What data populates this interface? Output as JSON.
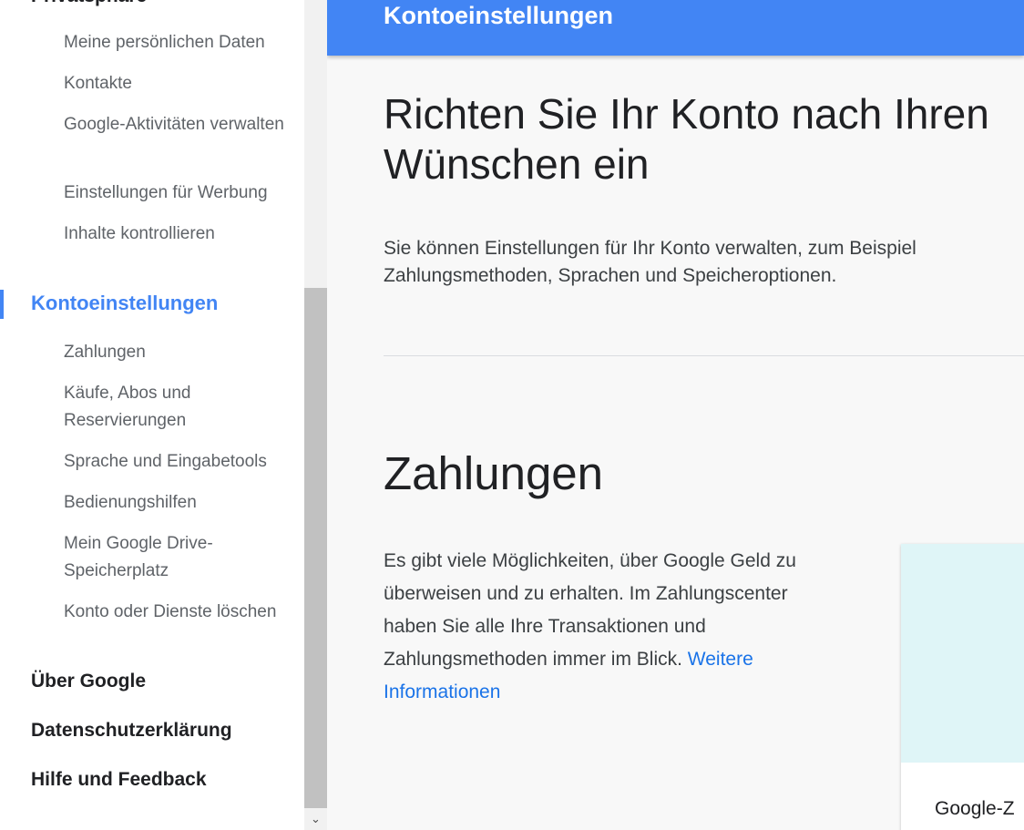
{
  "sidebar": {
    "privacy_heading": "Privatsphäre",
    "privacy_items": [
      {
        "label": "Meine persönlichen Daten"
      },
      {
        "label": "Kontakte"
      },
      {
        "label": "Google-Aktivitäten verwalten"
      },
      {
        "label": "Einstellungen für Werbung"
      },
      {
        "label": "Inhalte kontrollieren"
      }
    ],
    "account_heading": "Kontoeinstellungen",
    "account_items": [
      {
        "label": "Zahlungen"
      },
      {
        "label": "Käufe, Abos und Reservierungen"
      },
      {
        "label": "Sprache und Eingabetools"
      },
      {
        "label": "Bedienungshilfen"
      },
      {
        "label": "Mein Google Drive-Speicherplatz"
      },
      {
        "label": "Konto oder Dienste löschen"
      }
    ],
    "bottom_links": [
      {
        "label": "Über Google"
      },
      {
        "label": "Datenschutzerklärung"
      },
      {
        "label": "Hilfe und Feedback"
      }
    ]
  },
  "scrollbar": {
    "down_arrow": "⌄"
  },
  "header": {
    "title": "Kontoeinstellungen"
  },
  "main": {
    "hero_title": "Richten Sie Ihr Konto nach Ihren Wünschen ein",
    "hero_desc": "Sie können Einstellungen für Ihr Konto verwalten, zum Beispiel Zahlungsmethoden, Sprachen und Speicheroptionen.",
    "section_title": "Zahlungen",
    "section_desc": "Es gibt viele Möglichkeiten, über Google Geld zu überweisen und zu erhalten. Im Zahlungscenter haben Sie alle Ihre Transaktionen und Zahlungsmethoden immer im Blick.",
    "more_link": "Weitere Informationen",
    "card_label": "Google-Z"
  },
  "colors": {
    "accent": "#4285f4",
    "link": "#1a73e8",
    "card_image_bg": "#dff5f7"
  }
}
